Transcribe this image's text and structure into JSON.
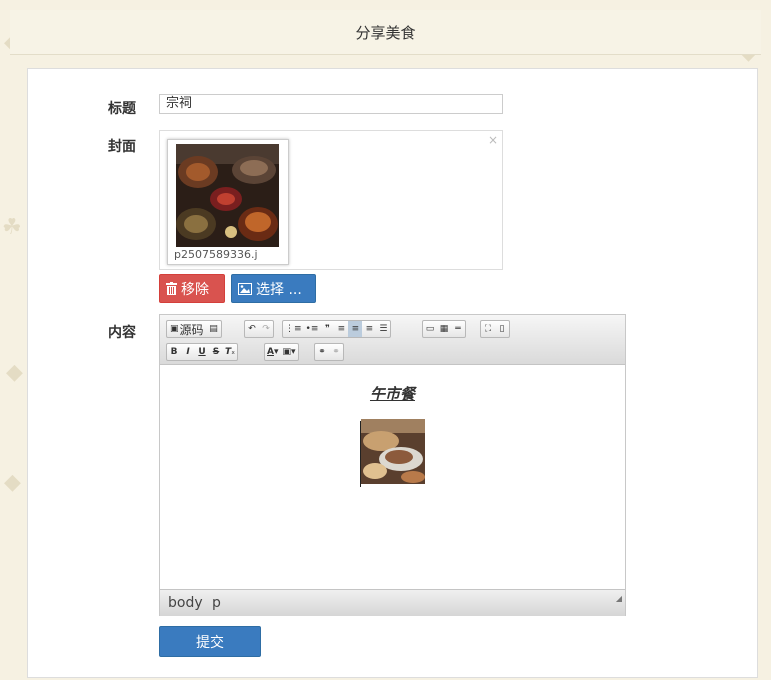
{
  "header": {
    "title": "分享美食"
  },
  "form": {
    "title_label": "标题",
    "title_value": "宗祠",
    "cover_label": "封面",
    "cover_close": "×",
    "cover_filename": "p2507589336.j",
    "remove_label": "移除",
    "choose_label": "选择 ...",
    "content_label": "内容",
    "submit_label": "提交"
  },
  "editor": {
    "source_label": "源码",
    "content_heading": "午市餐",
    "status_path": [
      "body",
      "p"
    ]
  },
  "colors": {
    "accent_blue": "#3a7bbf",
    "danger_red": "#d9534f",
    "page_bg": "#f6f1e2"
  }
}
